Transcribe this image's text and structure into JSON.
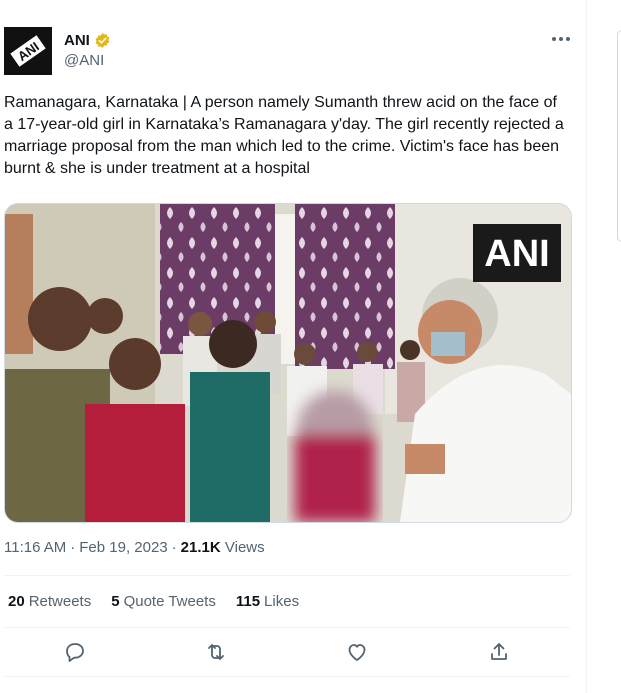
{
  "author": {
    "name": "ANI",
    "handle": "@ANI",
    "avatar_text": "ANI"
  },
  "tweet_text": "Ramanagara, Karnataka | A person namely Sumanth threw acid on the face of a 17-year-old girl in Karnataka’s Ramanagara y'day. The girl recently rejected a marriage proposal from the man which led to the crime. Victim's face has been burnt & she is under treatment at a hospital",
  "media": {
    "watermark": "ANI"
  },
  "meta": {
    "time": "11:16 AM",
    "separator1": "·",
    "date": "Feb 19, 2023",
    "separator2": "·",
    "views_count": "21.1K",
    "views_label": "Views"
  },
  "stats": {
    "retweets_count": "20",
    "retweets_label": "Retweets",
    "quotes_count": "5",
    "quotes_label": "Quote Tweets",
    "likes_count": "115",
    "likes_label": "Likes"
  },
  "icons": {
    "more": "more-icon",
    "reply": "reply-icon",
    "retweet": "retweet-icon",
    "like": "like-icon",
    "share": "share-icon",
    "verified": "verified-badge-icon"
  },
  "colors": {
    "text_primary": "#0f1419",
    "text_secondary": "#536471",
    "verified_gold": "#e2b719",
    "divider": "#eff3f4"
  }
}
